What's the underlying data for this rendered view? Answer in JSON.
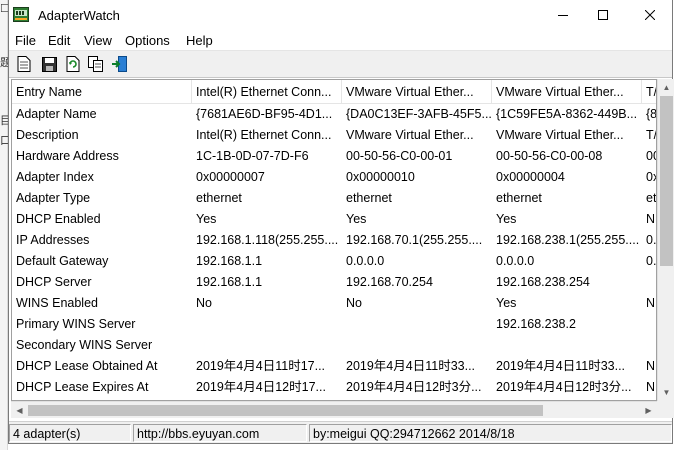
{
  "window": {
    "title": "AdapterWatch",
    "controls": {
      "minimize": "—",
      "maximize": "☐",
      "close": "✕"
    }
  },
  "background_app": {
    "left_glyphs": [
      "☐",
      "题",
      "目",
      "口"
    ]
  },
  "menubar": {
    "items": [
      "File",
      "Edit",
      "View",
      "Options",
      "Help"
    ]
  },
  "toolbar": {
    "buttons": [
      {
        "icon": "new-document-icon"
      },
      {
        "icon": "save-icon"
      },
      {
        "icon": "refresh-icon"
      },
      {
        "icon": "copy-icon"
      },
      {
        "icon": "exit-icon"
      }
    ]
  },
  "table": {
    "columns": [
      "Entry Name",
      "Intel(R) Ethernet Conn...",
      "VMware Virtual Ether...",
      "VMware Virtual Ether...",
      "T/"
    ],
    "rows": [
      [
        "Adapter Name",
        "{7681AE6D-BF95-4D1...",
        "{DA0C13EF-3AFB-45F5...",
        "{1C59FE5A-8362-449B...",
        "{8"
      ],
      [
        "Description",
        "Intel(R) Ethernet Conn...",
        "VMware Virtual Ether...",
        "VMware Virtual Ether...",
        "T/"
      ],
      [
        "Hardware Address",
        "1C-1B-0D-07-7D-F6",
        "00-50-56-C0-00-01",
        "00-50-56-C0-00-08",
        "00"
      ],
      [
        "Adapter Index",
        "0x00000007",
        "0x00000010",
        "0x00000004",
        "0x"
      ],
      [
        "Adapter Type",
        "ethernet",
        "ethernet",
        "ethernet",
        "et"
      ],
      [
        "DHCP Enabled",
        "Yes",
        "Yes",
        "Yes",
        "N"
      ],
      [
        "IP Addresses",
        "192.168.1.118(255.255....",
        "192.168.70.1(255.255....",
        "192.168.238.1(255.255....",
        "0."
      ],
      [
        "Default Gateway",
        "192.168.1.1",
        "0.0.0.0",
        "0.0.0.0",
        "0."
      ],
      [
        "DHCP Server",
        "192.168.1.1",
        "192.168.70.254",
        "192.168.238.254",
        ""
      ],
      [
        "WINS Enabled",
        "No",
        "No",
        "Yes",
        "N"
      ],
      [
        "Primary WINS Server",
        "",
        "",
        "192.168.238.2",
        ""
      ],
      [
        "Secondary  WINS Server",
        "",
        "",
        "",
        ""
      ],
      [
        "DHCP Lease Obtained At",
        "2019年4月4日11时17...",
        "2019年4月4日11时33...",
        "2019年4月4日11时33...",
        "N"
      ],
      [
        "DHCP Lease Expires At",
        "2019年4月4日12时17...",
        "2019年4月4日12时3分...",
        "2019年4月4日12时3分...",
        "N"
      ]
    ]
  },
  "statusbar": {
    "adapters": "4  adapter(s)",
    "url": "http://bbs.eyuyan.com",
    "credit": "by:meigui QQ:294712662 2014/8/18"
  }
}
